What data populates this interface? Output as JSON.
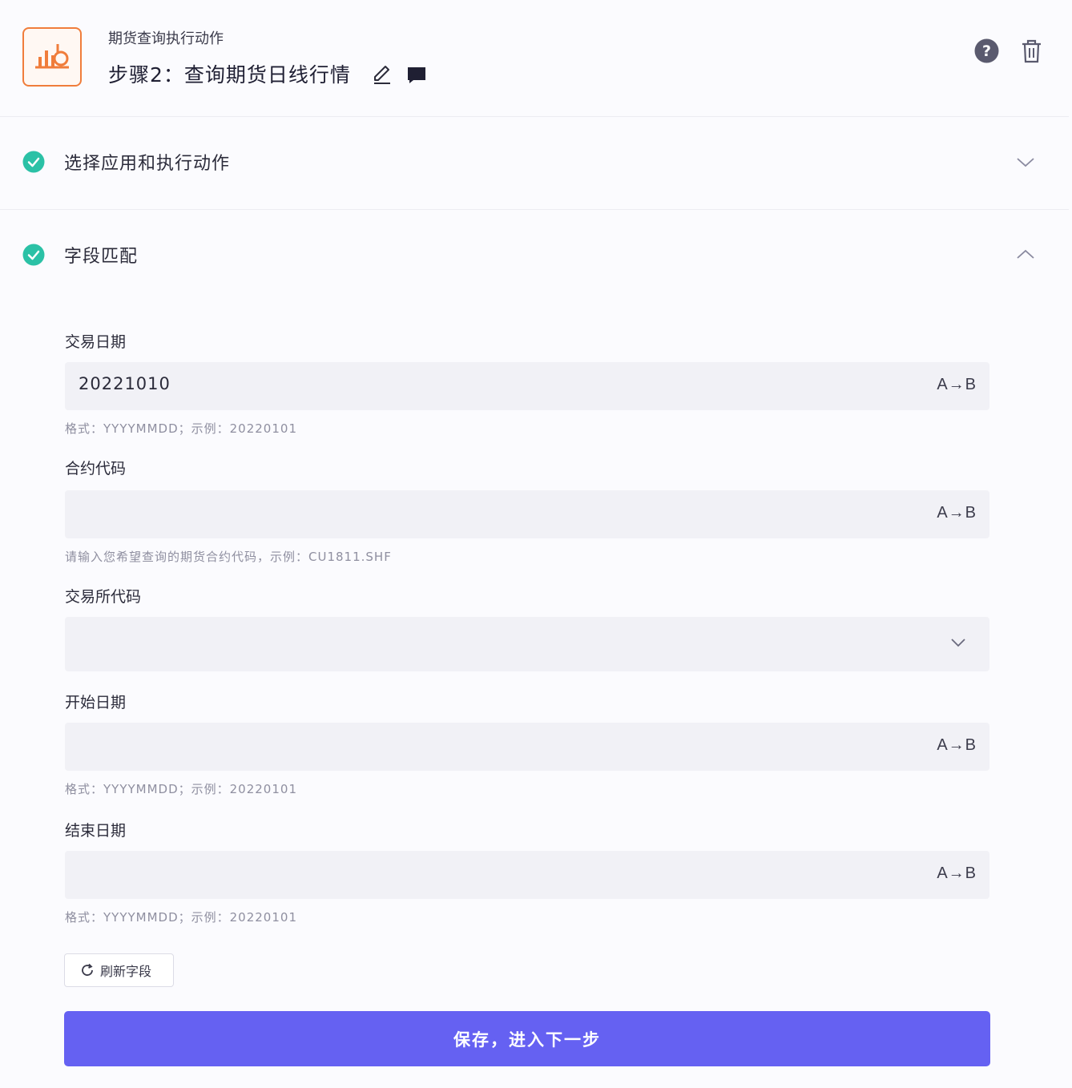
{
  "header": {
    "subtitle": "期货查询执行动作",
    "title": "步骤2：查询期货日线行情",
    "icons": {
      "logo": "futures-chart-icon",
      "edit": "pencil-icon",
      "comment": "comment-icon",
      "help": "help-icon",
      "delete": "trash-icon"
    }
  },
  "sections": [
    {
      "label": "选择应用和执行动作",
      "status": "complete",
      "expanded": false
    },
    {
      "label": "字段匹配",
      "status": "complete",
      "expanded": true
    }
  ],
  "fields": {
    "trade_date": {
      "label": "交易日期",
      "value": "20221010",
      "hint": "格式：YYYYMMDD；示例：20220101",
      "map_label": "A→B"
    },
    "contract_code": {
      "label": "合约代码",
      "value": "",
      "hint": "请输入您希望查询的期货合约代码，示例：CU1811.SHF",
      "map_label": "A→B"
    },
    "exchange_code": {
      "label": "交易所代码",
      "value": ""
    },
    "start_date": {
      "label": "开始日期",
      "value": "",
      "hint": "格式：YYYYMMDD；示例：20220101",
      "map_label": "A→B"
    },
    "end_date": {
      "label": "结束日期",
      "value": "",
      "hint": "格式：YYYYMMDD；示例：20220101",
      "map_label": "A→B"
    }
  },
  "actions": {
    "refresh_label": "刷新字段",
    "save_label": "保存，进入下一步"
  },
  "colors": {
    "primary": "#6561f2",
    "success": "#2bc1a6",
    "logo_accent": "#f07d3b"
  }
}
